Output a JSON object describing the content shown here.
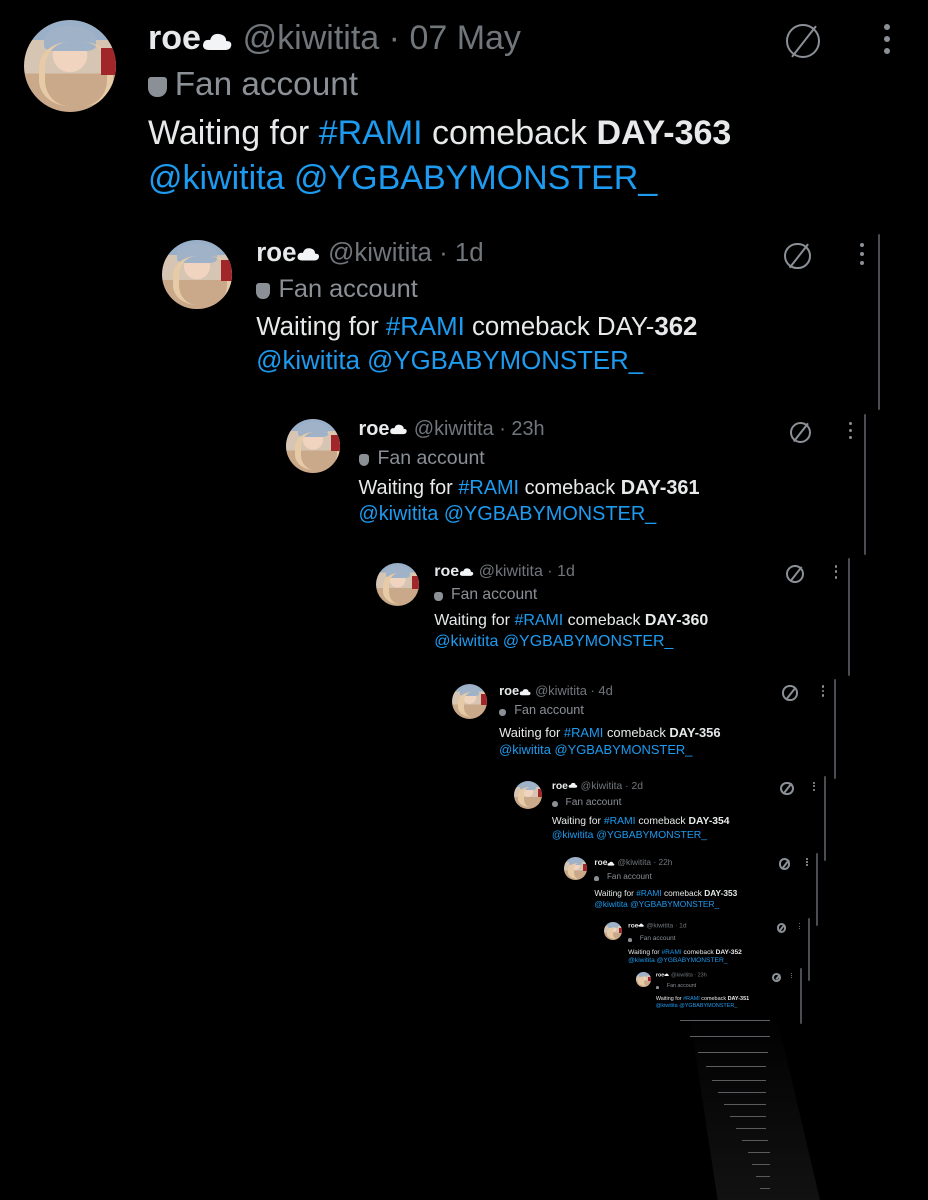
{
  "colors": {
    "background": "#000000",
    "text": "#e7e9ea",
    "muted": "#71767b",
    "link": "#1d9bf0"
  },
  "tweets": [
    {
      "name": "roe",
      "name_icon": "cloud-icon",
      "handle": "@kiwitita",
      "sep": "·",
      "time": "07 May",
      "badge": "Fan account",
      "text_prefix": "Waiting for ",
      "hashtag": "#RAMI",
      "text_mid": " comeback ",
      "day": "DAY-363",
      "mention1": "@kiwitita",
      "mention2": "@YGBABYMONSTER_"
    },
    {
      "name": "roe",
      "name_icon": "cloud-icon",
      "handle": "@kiwitita",
      "sep": "·",
      "time": "1d",
      "badge": "Fan account",
      "text_prefix": "Waiting for ",
      "hashtag": "#RAMI",
      "text_mid": " comeback DAY-",
      "day": "362",
      "mention1": "@kiwitita",
      "mention2": "@YGBABYMONSTER_"
    },
    {
      "name": "roe",
      "name_icon": "cloud-icon",
      "handle": "@kiwitita",
      "sep": "·",
      "time": "23h",
      "badge": "Fan account",
      "text_prefix": "Waiting for ",
      "hashtag": "#RAMI",
      "text_mid": " comeback ",
      "day": "DAY-361",
      "mention1": "@kiwitita",
      "mention2": "@YGBABYMONSTER_"
    },
    {
      "name": "roe",
      "name_icon": "cloud-icon",
      "handle": "@kiwitita",
      "sep": "·",
      "time": "1d",
      "badge": "Fan account",
      "text_prefix": "Waiting for ",
      "hashtag": "#RAMI",
      "text_mid": " comeback ",
      "day": "DAY-360",
      "mention1": "@kiwitita",
      "mention2": "@YGBABYMONSTER_"
    },
    {
      "name": "roe",
      "name_icon": "cloud-icon",
      "handle": "@kiwitita",
      "sep": "·",
      "time": "4d",
      "badge": "Fan account",
      "text_prefix": "Waiting for ",
      "hashtag": "#RAMI",
      "text_mid": " comeback ",
      "day": "DAY-356",
      "mention1": "@kiwitita",
      "mention2": "@YGBABYMONSTER_"
    },
    {
      "name": "roe",
      "name_icon": "cloud-icon",
      "handle": "@kiwitita",
      "sep": "·",
      "time": "2d",
      "badge": "Fan account",
      "text_prefix": "Waiting for ",
      "hashtag": "#RAMI",
      "text_mid": " comeback ",
      "day": "DAY-354",
      "mention1": "@kiwitita",
      "mention2": "@YGBABYMONSTER_"
    },
    {
      "name": "roe",
      "name_icon": "cloud-icon",
      "handle": "@kiwitita",
      "sep": "·",
      "time": "22h",
      "badge": "Fan account",
      "text_prefix": "Waiting for ",
      "hashtag": "#RAMI",
      "text_mid": " comeback ",
      "day": "DAY-353",
      "mention1": "@kiwitita",
      "mention2": "@YGBABYMONSTER_"
    },
    {
      "name": "roe",
      "name_icon": "cloud-icon",
      "handle": "@kiwitita",
      "sep": "·",
      "time": "1d",
      "badge": "Fan account",
      "text_prefix": "Waiting for ",
      "hashtag": "#RAMI",
      "text_mid": " comeback ",
      "day": "DAY-352",
      "mention1": "@kiwitita",
      "mention2": "@YGBABYMONSTER_"
    },
    {
      "name": "roe",
      "name_icon": "cloud-icon",
      "handle": "@kiwitita",
      "sep": "·",
      "time": "23h",
      "badge": "Fan account",
      "text_prefix": "Waiting for ",
      "hashtag": "#RAMI",
      "text_mid": " comeback ",
      "day": "DAY-351",
      "mention1": "@kiwitita",
      "mention2": "@YGBABYMONSTER_"
    }
  ]
}
